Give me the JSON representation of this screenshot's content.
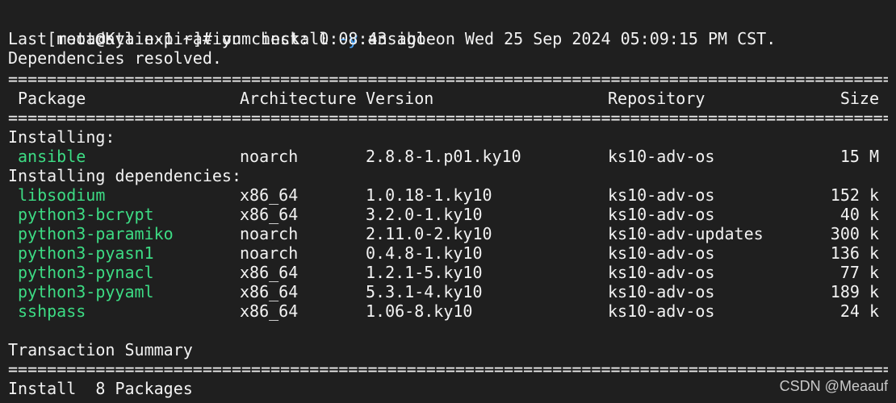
{
  "prompt": {
    "user_host": "[root@Kylin-1 ~]# ",
    "command_pre": "yum install ",
    "command_flag": "-y",
    "command_post": " ansible"
  },
  "output": {
    "metadata_line": "Last metadata expiration check: 0:08:43 ago on Wed 25 Sep 2024 05:09:15 PM CST.",
    "deps_resolved": "Dependencies resolved.",
    "separator": "=================================================================================================================================================================",
    "headers": {
      "package": "Package",
      "architecture": "Architecture",
      "version": "Version",
      "repository": "Repository",
      "size": "Size"
    },
    "installing_label": "Installing:",
    "installing": [
      {
        "name": "ansible",
        "arch": "noarch",
        "version": "2.8.8-1.p01.ky10",
        "repo": "ks10-adv-os",
        "size": "15 M"
      }
    ],
    "deps_label": "Installing dependencies:",
    "dependencies": [
      {
        "name": "libsodium",
        "arch": "x86_64",
        "version": "1.0.18-1.ky10",
        "repo": "ks10-adv-os",
        "size": "152 k"
      },
      {
        "name": "python3-bcrypt",
        "arch": "x86_64",
        "version": "3.2.0-1.ky10",
        "repo": "ks10-adv-os",
        "size": "40 k"
      },
      {
        "name": "python3-paramiko",
        "arch": "noarch",
        "version": "2.11.0-2.ky10",
        "repo": "ks10-adv-updates",
        "size": "300 k"
      },
      {
        "name": "python3-pyasn1",
        "arch": "noarch",
        "version": "0.4.8-1.ky10",
        "repo": "ks10-adv-os",
        "size": "136 k"
      },
      {
        "name": "python3-pynacl",
        "arch": "x86_64",
        "version": "1.2.1-5.ky10",
        "repo": "ks10-adv-os",
        "size": "77 k"
      },
      {
        "name": "python3-pyyaml",
        "arch": "x86_64",
        "version": "5.3.1-4.ky10",
        "repo": "ks10-adv-os",
        "size": "189 k"
      },
      {
        "name": "sshpass",
        "arch": "x86_64",
        "version": "1.06-8.ky10",
        "repo": "ks10-adv-os",
        "size": "24 k"
      }
    ],
    "summary_label": "Transaction Summary",
    "install_line": "Install  8 Packages"
  },
  "watermark": "CSDN @Meaauf",
  "colors": {
    "background": "#1f1f1f",
    "text": "#f2f2f2",
    "package_name": "#3ddc84",
    "flag": "#4aa8ff"
  }
}
